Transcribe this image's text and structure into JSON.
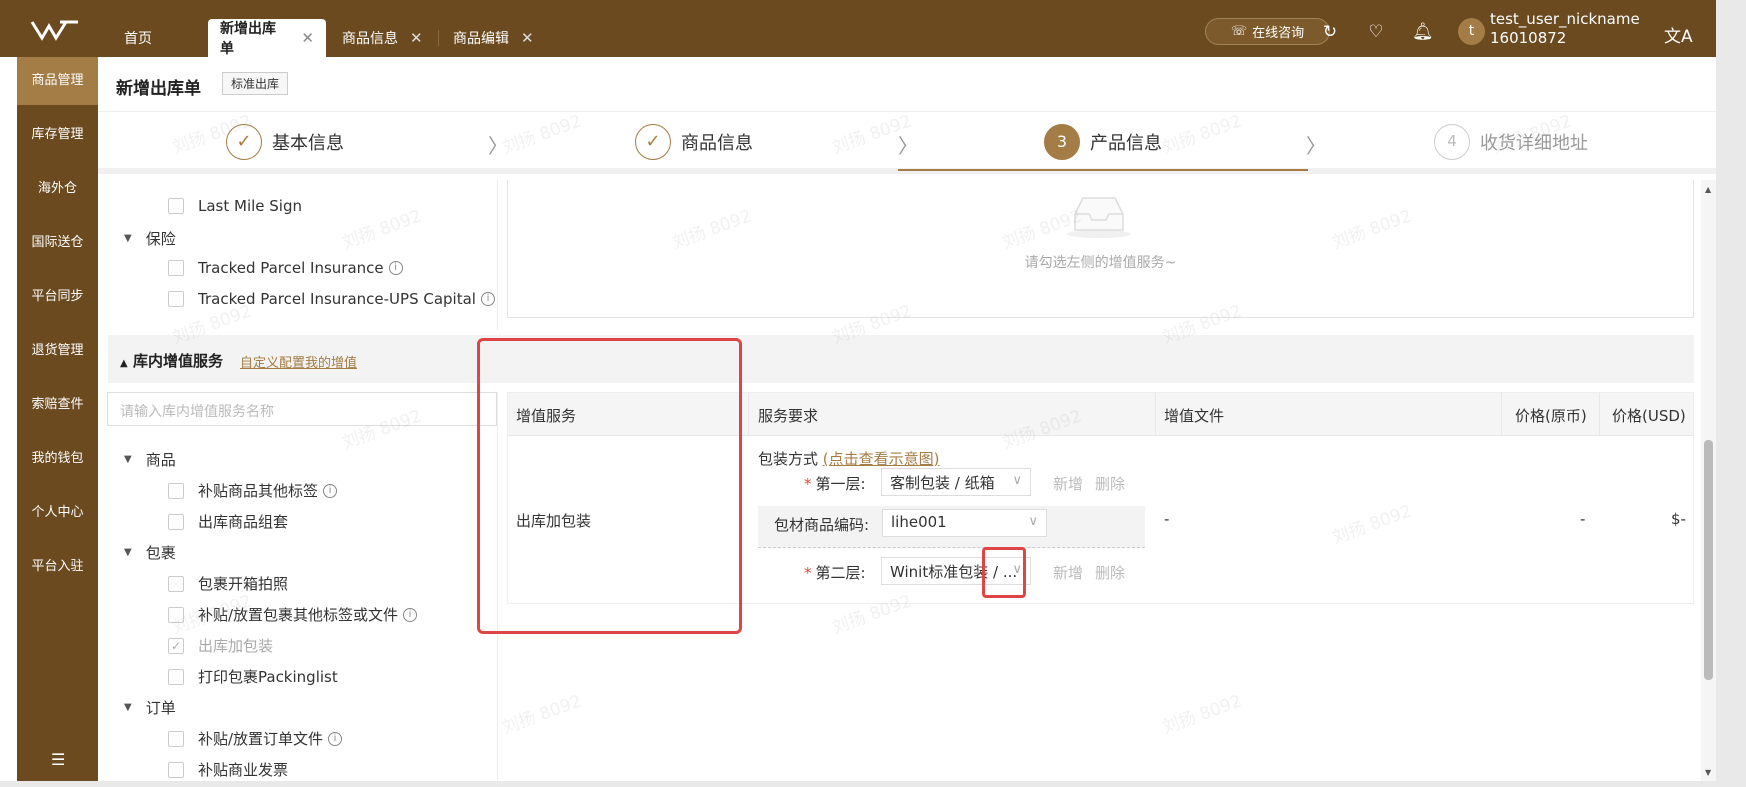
{
  "colors": {
    "brand": "#6b4a1f",
    "accent": "#a47c45",
    "highlight": "#e04545"
  },
  "tabs": [
    {
      "label": "首页",
      "closable": false,
      "active": false
    },
    {
      "label": "新增出库单",
      "closable": true,
      "active": true
    },
    {
      "label": "商品信息",
      "closable": true,
      "active": false
    },
    {
      "label": "商品编辑",
      "closable": true,
      "active": false
    }
  ],
  "topbar": {
    "consult": "在线咨询",
    "user_name": "test_user_nickname",
    "user_id": "16010872",
    "avatar_letter": "t",
    "icons": [
      "refresh-icon",
      "heart-shield-icon",
      "bell-icon",
      "translate-icon"
    ]
  },
  "sidebar": {
    "items": [
      "商品管理",
      "库存管理",
      "海外仓",
      "国际送仓",
      "平台同步",
      "退货管理",
      "索赔查件",
      "我的钱包",
      "个人中心",
      "平台入驻"
    ],
    "active_index": 0
  },
  "header": {
    "title": "新增出库单",
    "tag": "标准出库"
  },
  "steps": [
    {
      "label": "基本信息",
      "state": "done",
      "mark": ""
    },
    {
      "label": "商品信息",
      "state": "done",
      "mark": ""
    },
    {
      "label": "产品信息",
      "state": "current",
      "mark": "3"
    },
    {
      "label": "收货详细地址",
      "state": "todo",
      "mark": "4"
    }
  ],
  "tree_top": {
    "last_mile": "Last Mile Sign",
    "insurance_group": "保险",
    "insurance_items": [
      "Tracked Parcel Insurance",
      "Tracked Parcel Insurance-UPS Capital"
    ]
  },
  "empty": {
    "text": "请勾选左侧的增值服务~"
  },
  "warehouse_section": {
    "title": "库内增值服务",
    "link": "自定义配置我的增值",
    "search_placeholder": "请输入库内增值服务名称"
  },
  "tree_bottom": {
    "group_goods": "商品",
    "goods_items": [
      "补贴商品其他标签",
      "出库商品组套"
    ],
    "group_parcel": "包裹",
    "parcel_items": [
      "包裹开箱拍照",
      "补贴/放置包裹其他标签或文件",
      "出库加包装",
      "打印包裹Packinglist"
    ],
    "group_order": "订单",
    "order_items": [
      "补贴/放置订单文件",
      "补贴商业发票"
    ]
  },
  "table": {
    "headers": [
      "增值服务",
      "服务要求",
      "增值文件",
      "价格(原币)",
      "价格(USD)"
    ],
    "row": {
      "service": "出库加包装",
      "pack_method_label": "包装方式",
      "pack_method_link": "(点击查看示意图)",
      "layer1_label": "第一层:",
      "layer1_value": "客制包装 / 纸箱",
      "add": "新增",
      "delete": "删除",
      "code_label": "包材商品编码:",
      "code_value": "lihe001",
      "layer2_label": "第二层:",
      "layer2_value": "Winit标准包装 / ...",
      "file": "-",
      "price_orig": "-",
      "price_usd": "$-"
    }
  },
  "watermark": "刘扬 8092"
}
